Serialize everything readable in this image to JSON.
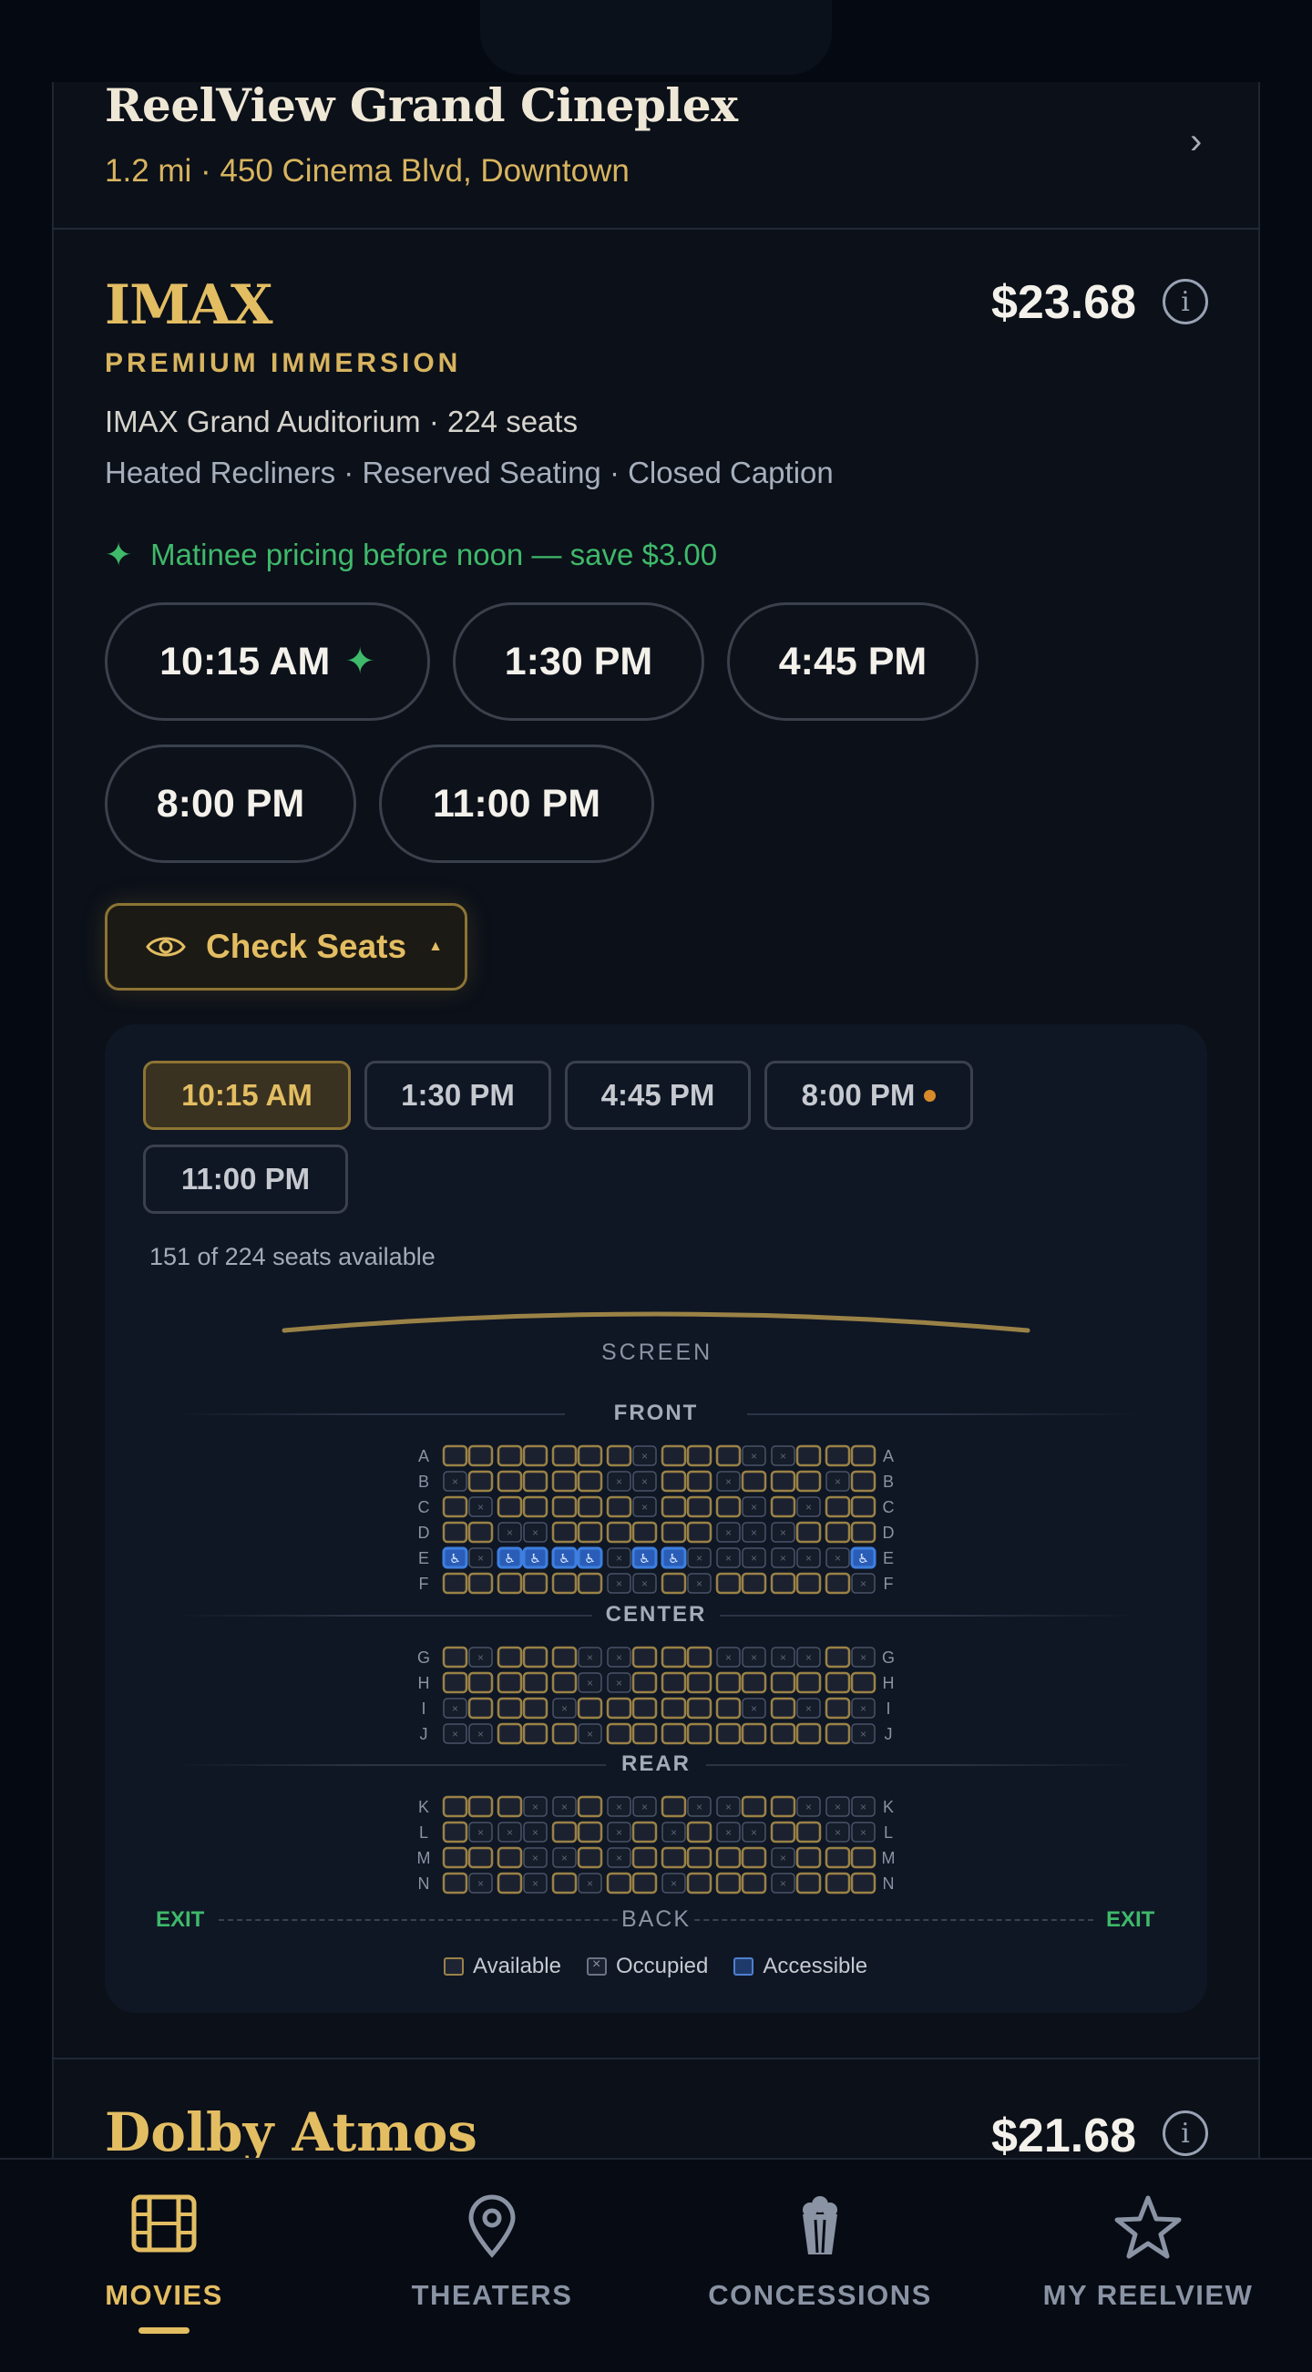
{
  "theater": {
    "name": "ReelView Grand Cineplex",
    "address": "1.2 mi · 450 Cinema Blvd, Downtown",
    "chevron": "›"
  },
  "format": {
    "title": "IMAX",
    "subtitle": "PREMIUM IMMERSION",
    "price": "$23.68",
    "info_icon": "i",
    "auditorium": "IMAX Grand Auditorium · 224 seats",
    "amenities": "Heated Recliners · Reserved Seating · Closed Caption",
    "promo_icon": "✦",
    "promo": "Matinee pricing before noon — save $3.00",
    "showtimes": [
      {
        "time": "10:15 AM",
        "matinee": true
      },
      {
        "time": "1:30 PM",
        "matinee": false
      },
      {
        "time": "4:45 PM",
        "matinee": false
      },
      {
        "time": "8:00 PM",
        "matinee": false
      },
      {
        "time": "11:00 PM",
        "matinee": false
      }
    ],
    "check_seats_label": "Check Seats",
    "check_seats_caret": "▲"
  },
  "seat_map": {
    "chips": [
      {
        "time": "10:15 AM",
        "active": true,
        "dot": false
      },
      {
        "time": "1:30 PM",
        "active": false,
        "dot": false
      },
      {
        "time": "4:45 PM",
        "active": false,
        "dot": false
      },
      {
        "time": "8:00 PM",
        "active": false,
        "dot": true
      },
      {
        "time": "11:00 PM",
        "active": false,
        "dot": false
      }
    ],
    "availability": "151 of 224 seats available",
    "screen_label": "SCREEN",
    "sections": [
      {
        "label": "FRONT",
        "rows": [
          "A",
          "B",
          "C",
          "D",
          "E",
          "F"
        ]
      },
      {
        "label": "CENTER",
        "rows": [
          "G",
          "H",
          "I",
          "J"
        ]
      },
      {
        "label": "REAR",
        "rows": [
          "K",
          "L",
          "M",
          "N"
        ]
      }
    ],
    "accessible_row": "E",
    "seats_per_row": 16,
    "exit_left": "EXIT",
    "exit_right": "EXIT",
    "back_label": "BACK",
    "legend": {
      "available": "Available",
      "occupied": "Occupied",
      "accessible": "Accessible"
    },
    "colors": {
      "available": "#9a8246",
      "occupied": "#4a5366",
      "accessible": "#3e7fe0"
    }
  },
  "next_format": {
    "title": "Dolby Atmos",
    "price": "$21.68",
    "info_icon": "i"
  },
  "nav": {
    "items": [
      {
        "label": "MOVIES",
        "icon": "film-icon",
        "active": true
      },
      {
        "label": "THEATERS",
        "icon": "map-pin-icon",
        "active": false
      },
      {
        "label": "CONCESSIONS",
        "icon": "popcorn-icon",
        "active": false
      },
      {
        "label": "MY REELVIEW",
        "icon": "star-icon",
        "active": false
      }
    ]
  },
  "colors": {
    "accent": "#e3bd62",
    "success": "#3fb96a",
    "background": "#0b1019"
  }
}
